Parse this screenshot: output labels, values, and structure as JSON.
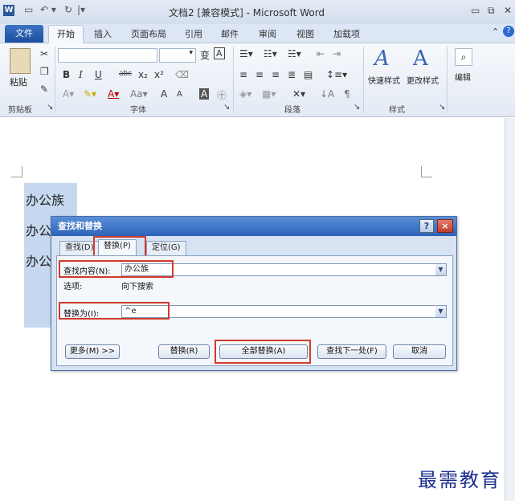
{
  "window": {
    "title": "文档2 [兼容模式] - Microsoft Word",
    "logo": "W"
  },
  "quick_access": {
    "save_icon": "save-icon",
    "undo_icon": "undo-icon",
    "redo_icon": "redo-icon",
    "customize_icon": "customize-icon"
  },
  "tabs": {
    "file": "文件",
    "items": [
      "开始",
      "插入",
      "页面布局",
      "引用",
      "邮件",
      "审阅",
      "视图",
      "加载项"
    ],
    "active": "开始"
  },
  "ribbon": {
    "clipboard": {
      "paste": "粘贴",
      "label": "剪贴板"
    },
    "font": {
      "label": "字体",
      "font_name": "",
      "font_size": "",
      "grow": "A",
      "shrink": "A",
      "bold": "B",
      "italic": "I",
      "underline": "U",
      "strike": "abc",
      "sub": "x₂",
      "sup": "x²",
      "wen": "变",
      "boxA": "A"
    },
    "paragraph": {
      "label": "段落"
    },
    "styles": {
      "quick": "快速样式",
      "change": "更改样式",
      "label": "样式"
    },
    "editing": {
      "label": "编辑"
    }
  },
  "document": {
    "lines": [
      "办公族",
      "办公",
      "办公"
    ]
  },
  "dialog": {
    "title": "查找和替换",
    "help": "?",
    "close": "×",
    "tabs": [
      "查找(D)",
      "替换(P)",
      "定位(G)"
    ],
    "find_label": "查找内容(N):",
    "find_value": "办公族",
    "options_label": "选项:",
    "options_value": "向下搜索",
    "replace_label": "替换为(I):",
    "replace_value": "^e",
    "buttons": {
      "more": "更多(M) >>",
      "replace": "替换(R)",
      "replace_all": "全部替换(A)",
      "find_next": "查找下一处(F)",
      "cancel": "取消"
    }
  },
  "watermark": "最需教育"
}
